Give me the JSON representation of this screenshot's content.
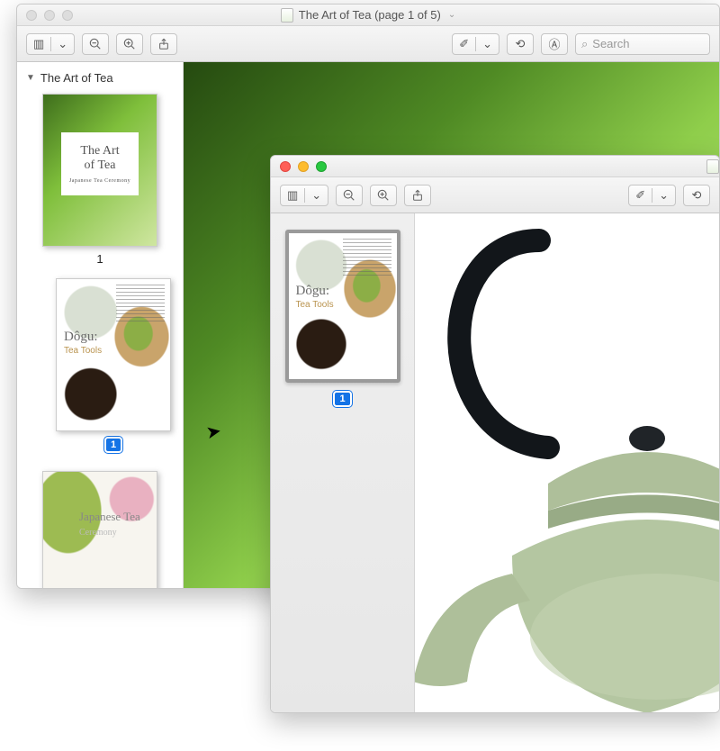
{
  "bgWindow": {
    "title": "The Art of Tea (page 1 of 5)",
    "search_placeholder": "Search",
    "sidebar": {
      "doc_title": "The Art of Tea",
      "cover": {
        "line1": "The Art",
        "line2": "of Tea",
        "caption": "Japanese Tea Ceremony"
      },
      "page1_label": "1",
      "dogu": {
        "title": "Dôgu:",
        "subtitle": "Tea Tools",
        "badge": "1"
      },
      "japan": {
        "title": "Japanese Tea",
        "subtitle": "Ceremony"
      }
    }
  },
  "fgWindow": {
    "thumb": {
      "title": "Dôgu:",
      "subtitle": "Tea Tools",
      "badge": "1"
    }
  },
  "icons": {
    "sidebar_glyph": "▥",
    "zoom_out": "−",
    "zoom_in": "+",
    "share": "⇪",
    "highlighter": "✐",
    "dropdown": "⌄",
    "rotate": "⟲",
    "annotate": "Ⓐ",
    "search": "⌕",
    "chevron": "⌄",
    "triangle": "▼"
  }
}
